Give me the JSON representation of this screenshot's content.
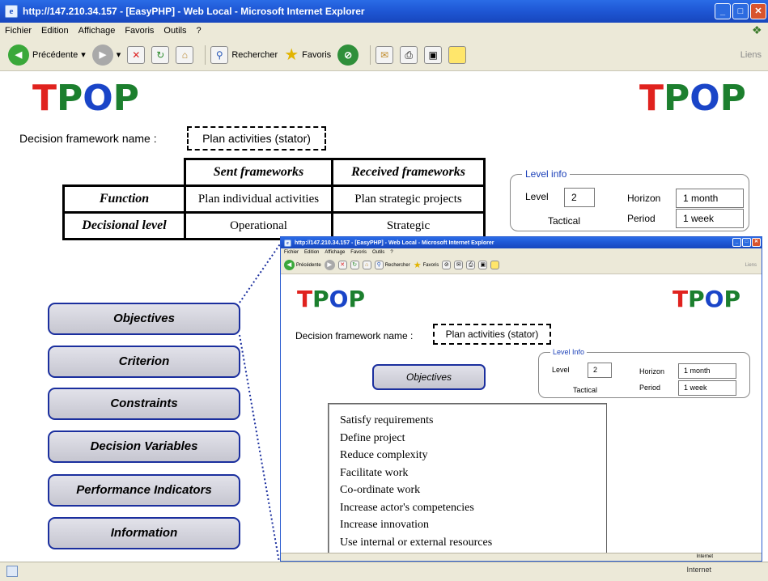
{
  "window": {
    "title": "http://147.210.34.157 - [EasyPHP] - Web Local - Microsoft Internet Explorer",
    "menu": [
      "Fichier",
      "Edition",
      "Affichage",
      "Favoris",
      "Outils",
      "?"
    ],
    "toolbar": {
      "back": "Précédente",
      "search": "Rechercher",
      "favorites": "Favoris",
      "links": "Liens"
    },
    "status": {
      "zone": "Internet"
    }
  },
  "logo": {
    "p1": "T",
    "p2": "P",
    "p3": "O",
    "p4": "P"
  },
  "decision_framework": {
    "label": "Decision framework name :",
    "value": "Plan activities (stator)"
  },
  "frames_table": {
    "headers": [
      "Sent frameworks",
      "Received frameworks"
    ],
    "rows": [
      {
        "label": "Function",
        "sent": "Plan individual activities",
        "received": "Plan strategic projects"
      },
      {
        "label": "Decisional level",
        "sent": "Operational",
        "received": "Strategic"
      }
    ]
  },
  "level_info": {
    "legend": "Level info",
    "level_label": "Level",
    "level_value": "2",
    "level_name": "Tactical",
    "horizon_label": "Horizon",
    "horizon_value": "1 month",
    "period_label": "Period",
    "period_value": "1 week"
  },
  "nav_buttons": [
    "Objectives",
    "Criterion",
    "Constraints",
    "Decision Variables",
    "Performance Indicators",
    "Information"
  ],
  "inner_window": {
    "title": "http://147.210.34.157 - [EasyPHP] - Web Local - Microsoft Internet Explorer",
    "decision_framework": {
      "label": "Decision framework name :",
      "value": "Plan activities (stator)"
    },
    "level_info": {
      "legend": "Level Info",
      "level_label": "Level",
      "level_value": "2",
      "level_name": "Tactical",
      "horizon_label": "Horizon",
      "horizon_value": "1 month",
      "period_label": "Period",
      "period_value": "1 week"
    },
    "active_button": "Objectives",
    "objectives": [
      "Satisfy requirements",
      "Define project",
      "Reduce complexity",
      "Facilitate work",
      "Co-ordinate work",
      "Increase actor's competencies",
      "Increase innovation",
      "Use internal or external resources"
    ],
    "status": {
      "zone": "Internet"
    }
  },
  "colors": {
    "title_bar": "#1f58d6",
    "button_border": "#1b2f9e",
    "button_fill": "#c6c6d0",
    "legend": "#1a3fb8",
    "connector": "#1b2f9e"
  }
}
